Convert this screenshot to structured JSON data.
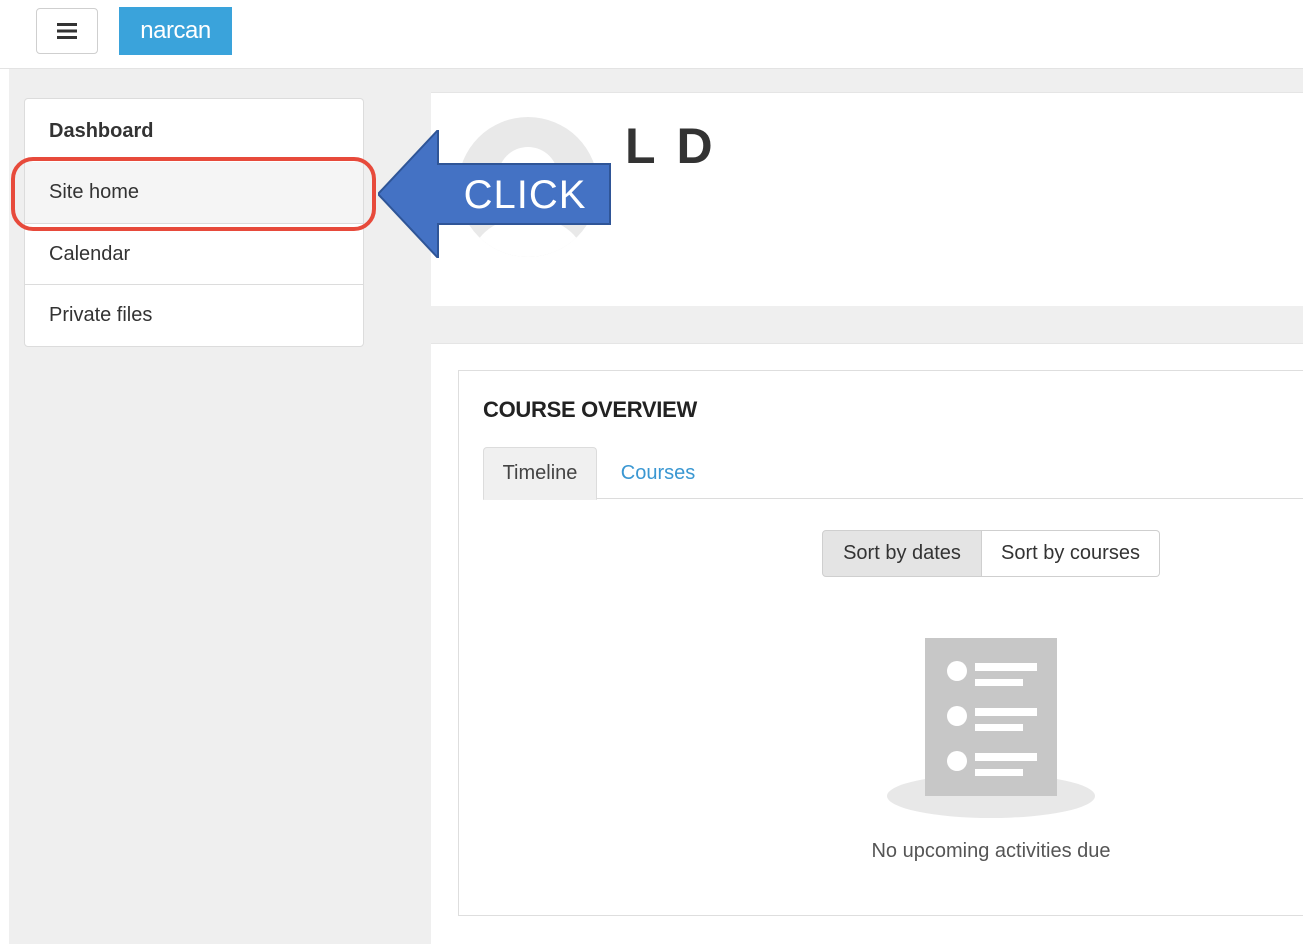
{
  "navbar": {
    "brand": "narcan",
    "menu_icon": "hamburger-icon"
  },
  "sidebar": {
    "items": [
      {
        "label": "Dashboard"
      },
      {
        "label": "Site home"
      },
      {
        "label": "Calendar"
      },
      {
        "label": "Private files"
      }
    ]
  },
  "header": {
    "user_name": "L D",
    "avatar_icon": "user-avatar-icon"
  },
  "course_overview": {
    "title": "COURSE OVERVIEW",
    "tabs": [
      {
        "label": "Timeline"
      },
      {
        "label": "Courses"
      }
    ],
    "sort_buttons": [
      {
        "label": "Sort by dates"
      },
      {
        "label": "Sort by courses"
      }
    ],
    "empty_icon": "empty-list-icon",
    "empty_message": "No upcoming activities due"
  },
  "annotation": {
    "label": "CLICK",
    "arrow_color": "#4472c4",
    "ring_color": "#e74a3b"
  },
  "colors": {
    "brand": "#3aa3db",
    "link": "#3a97d2",
    "page_bg": "#efefef"
  }
}
